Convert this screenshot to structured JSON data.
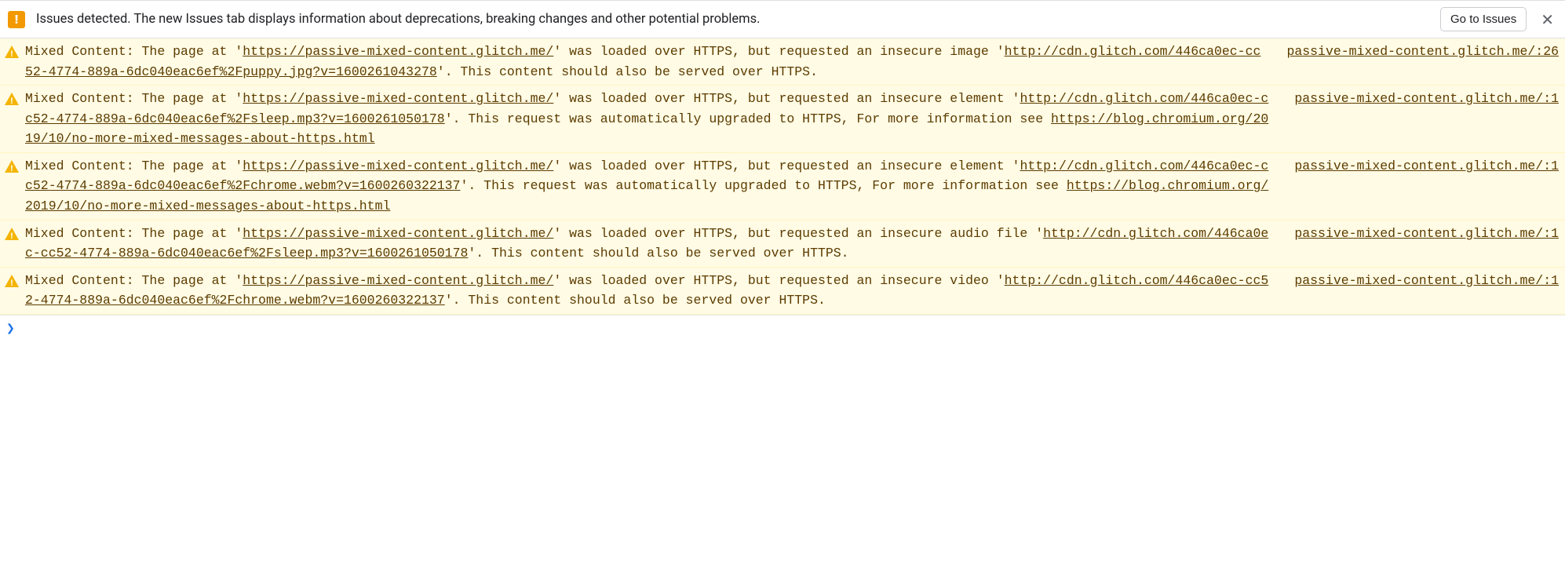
{
  "issuesBar": {
    "text": "Issues detected. The new Issues tab displays information about deprecations, breaking changes and other potential problems.",
    "button": "Go to Issues",
    "close": "✕"
  },
  "page_url": "https://passive-mixed-content.glitch.me/",
  "messages": [
    {
      "source": "passive-mixed-content.glitch.me/:26",
      "t1": "Mixed Content: The page at '",
      "t2": "' was loaded over HTTPS, but requested an insecure image '",
      "resource": "http://cdn.glitch.com/446ca0ec-cc52-4774-889a-6dc040eac6ef%2Fpuppy.jpg?v=1600261043278",
      "t3": "'. This content should also be served over HTTPS.",
      "info_link": ""
    },
    {
      "source": "passive-mixed-content.glitch.me/:1",
      "t1": "Mixed Content: The page at '",
      "t2": "' was loaded over HTTPS, but requested an insecure element '",
      "resource": "http://cdn.glitch.com/446ca0ec-cc52-4774-889a-6dc040eac6ef%2Fsleep.mp3?v=1600261050178",
      "t3": "'. This request was automatically upgraded to HTTPS, For more information see ",
      "info_link": "https://blog.chromium.org/2019/10/no-more-mixed-messages-about-https.html"
    },
    {
      "source": "passive-mixed-content.glitch.me/:1",
      "t1": "Mixed Content: The page at '",
      "t2": "' was loaded over HTTPS, but requested an insecure element '",
      "resource": "http://cdn.glitch.com/446ca0ec-cc52-4774-889a-6dc040eac6ef%2Fchrome.webm?v=1600260322137",
      "t3": "'. This request was automatically upgraded to HTTPS, For more information see ",
      "info_link": "https://blog.chromium.org/2019/10/no-more-mixed-messages-about-https.html"
    },
    {
      "source": "passive-mixed-content.glitch.me/:1",
      "t1": "Mixed Content: The page at '",
      "t2": "' was loaded over HTTPS, but requested an insecure audio file '",
      "resource": "http://cdn.glitch.com/446ca0ec-cc52-4774-889a-6dc040eac6ef%2Fsleep.mp3?v=1600261050178",
      "t3": "'. This content should also be served over HTTPS.",
      "info_link": ""
    },
    {
      "source": "passive-mixed-content.glitch.me/:1",
      "t1": "Mixed Content: The page at '",
      "t2": "' was loaded over HTTPS, but requested an insecure video '",
      "resource": "http://cdn.glitch.com/446ca0ec-cc52-4774-889a-6dc040eac6ef%2Fchrome.webm?v=1600260322137",
      "t3": "'. This content should also be served over HTTPS.",
      "info_link": ""
    }
  ],
  "prompt": "❯"
}
